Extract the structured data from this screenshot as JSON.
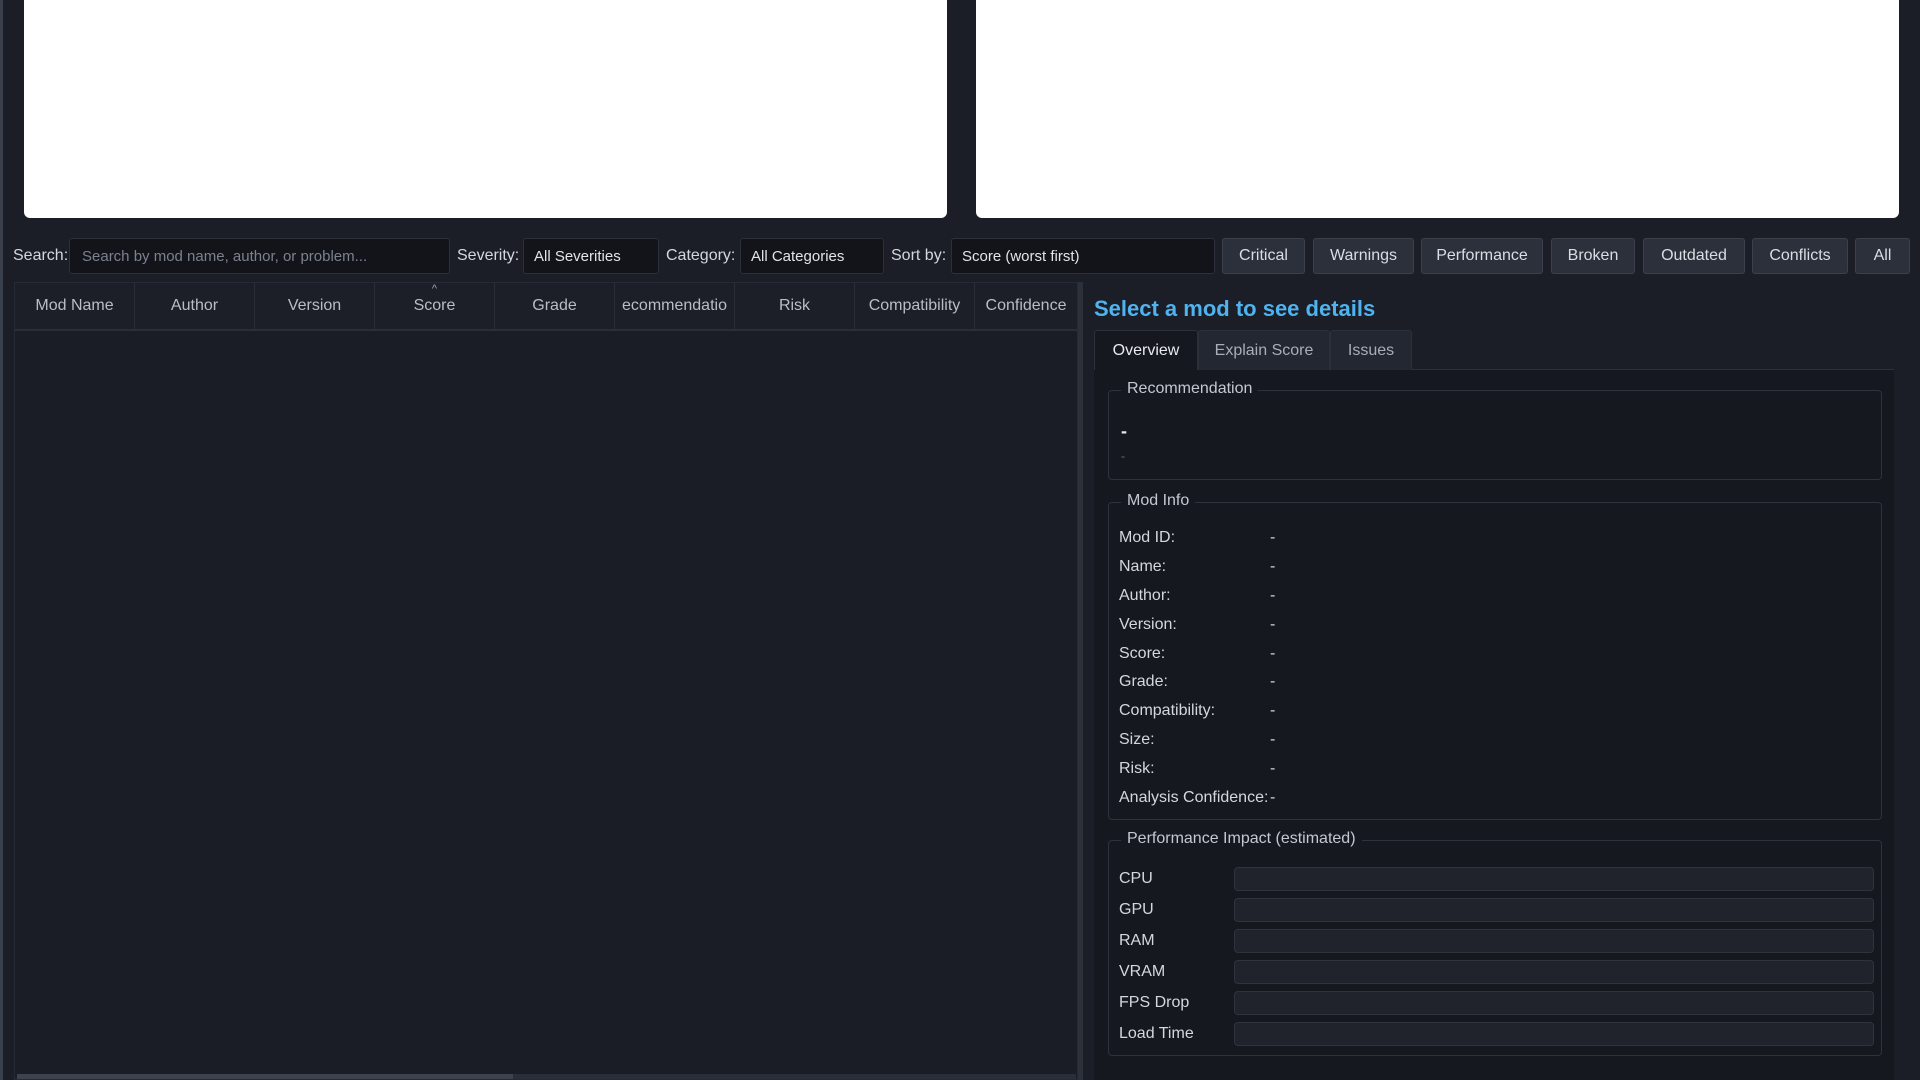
{
  "toolbar": {
    "search_label": "Search:",
    "search_placeholder": "Search by mod name, author, or problem...",
    "search_value": "",
    "severity_label": "Severity:",
    "severity_value": "All Severities",
    "category_label": "Category:",
    "category_value": "All Categories",
    "sort_label": "Sort by:",
    "sort_value": "Score (worst first)",
    "filters": [
      {
        "label": "Critical"
      },
      {
        "label": "Warnings"
      },
      {
        "label": "Performance"
      },
      {
        "label": "Broken"
      },
      {
        "label": "Outdated"
      },
      {
        "label": "Conflicts"
      },
      {
        "label": "All"
      }
    ]
  },
  "table": {
    "columns": [
      "Mod Name",
      "Author",
      "Version",
      "Score",
      "Grade",
      "ecommendatio",
      "Risk",
      "Compatibility",
      "Confidence"
    ],
    "sort_caret": "^",
    "rows": []
  },
  "details": {
    "title": "Select a mod to see details",
    "tabs": [
      {
        "label": "Overview",
        "active": true
      },
      {
        "label": "Explain Score",
        "active": false
      },
      {
        "label": "Issues",
        "active": false
      }
    ],
    "recommendation": {
      "title": "Recommendation",
      "value": "-",
      "sub": "-"
    },
    "mod_info": {
      "title": "Mod Info",
      "rows": [
        {
          "label": "Mod ID:",
          "value": "-"
        },
        {
          "label": "Name:",
          "value": "-"
        },
        {
          "label": "Author:",
          "value": "-"
        },
        {
          "label": "Version:",
          "value": "-"
        },
        {
          "label": "Score:",
          "value": "-"
        },
        {
          "label": "Grade:",
          "value": "-"
        },
        {
          "label": "Compatibility:",
          "value": "-"
        },
        {
          "label": "Size:",
          "value": "-"
        },
        {
          "label": "Risk:",
          "value": "-"
        },
        {
          "label": "Analysis Confidence:",
          "value": "-"
        }
      ]
    },
    "performance": {
      "title": "Performance Impact (estimated)",
      "rows": [
        {
          "label": "CPU",
          "value": 0
        },
        {
          "label": "GPU",
          "value": 0
        },
        {
          "label": "RAM",
          "value": 0
        },
        {
          "label": "VRAM",
          "value": 0
        },
        {
          "label": "FPS Drop",
          "value": 0
        },
        {
          "label": "Load Time",
          "value": 0
        }
      ]
    }
  },
  "colors": {
    "accent": "#4fb3ef",
    "background": "#1b1e27",
    "panel": "#161820"
  }
}
